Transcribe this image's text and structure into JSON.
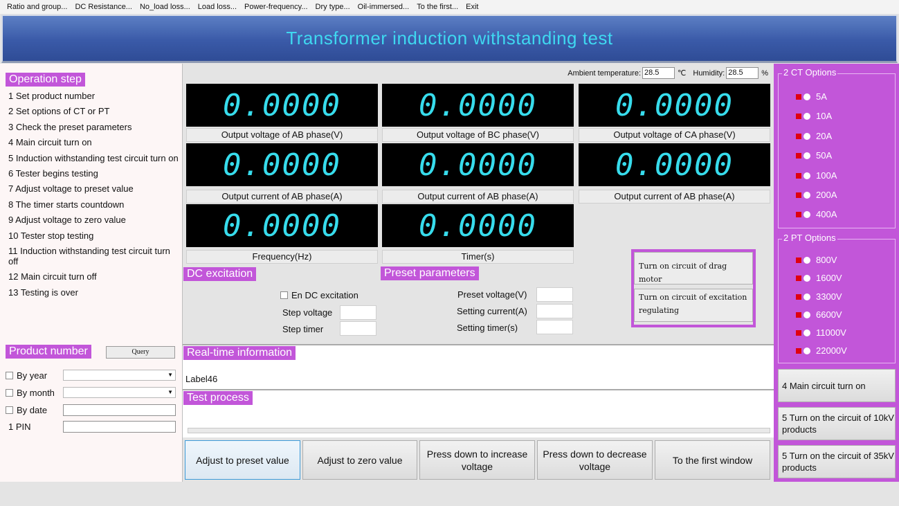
{
  "menu": [
    "Ratio and group...",
    "DC Resistance...",
    "No_load loss...",
    "Load loss...",
    "Power-frequency...",
    "Dry type...",
    "Oil-immersed...",
    "To the first...",
    "Exit"
  ],
  "header": {
    "title": "Transformer induction withstanding test"
  },
  "operation": {
    "title": "Operation step",
    "steps": [
      "1 Set product number",
      "2 Set options of CT or PT",
      "3 Check the preset parameters",
      "4 Main circuit turn on",
      "5 Induction withstanding test circuit turn on",
      "6 Tester begins testing",
      "7 Adjust voltage to preset value",
      "8 The timer starts countdown",
      "9 Adjust voltage to zero value",
      "10 Tester stop testing",
      "11 Induction withstanding test circuit turn off",
      "12 Main circuit turn off",
      "13 Testing is over"
    ]
  },
  "product": {
    "title": "Product number",
    "query": "Query",
    "by_year": "By year",
    "by_month": "By month",
    "by_date": "By date",
    "pin": "1 PIN"
  },
  "environment": {
    "temp_label": "Ambient temperature:",
    "temp_value": "28.5",
    "temp_unit": "℃",
    "humidity_label": "Humidity:",
    "humidity_value": "28.5",
    "humidity_unit": "%"
  },
  "meters": [
    {
      "value": "0.0000",
      "caption": "Output voltage of AB phase(V)"
    },
    {
      "value": "0.0000",
      "caption": "Output voltage of BC phase(V)"
    },
    {
      "value": "0.0000",
      "caption": "Output voltage of CA phase(V)"
    },
    {
      "value": "0.0000",
      "caption": "Output current of AB phase(A)"
    },
    {
      "value": "0.0000",
      "caption": "Output current of AB phase(A)"
    },
    {
      "value": "0.0000",
      "caption": "Output current of AB phase(A)"
    },
    {
      "value": "0.0000",
      "caption": "Frequency(Hz)"
    },
    {
      "value": "0.0000",
      "caption": "Timer(s)"
    }
  ],
  "dc": {
    "title": "DC excitation",
    "enable": "En DC excitation",
    "step_voltage": "Step voltage",
    "step_timer": "Step timer"
  },
  "preset": {
    "title": "Preset parameters",
    "voltage": "Preset voltage(V)",
    "current": "Setting current(A)",
    "timer": "Setting timer(s)"
  },
  "motor": {
    "drag": "Turn on circuit of drag motor",
    "excitation": "Turn on circuit of excitation regulating"
  },
  "realtime": {
    "title": "Real-time information",
    "label": "Label46"
  },
  "process": {
    "title": "Test process",
    "progress": 0
  },
  "actions": [
    "Adjust to preset value",
    "Adjust to zero value",
    "Press down to increase voltage",
    "Press down to decrease voltage",
    "To the first window"
  ],
  "ct": {
    "title": "2 CT Options",
    "options": [
      "5A",
      "10A",
      "20A",
      "50A",
      "100A",
      "200A",
      "400A"
    ]
  },
  "pt": {
    "title": "2 PT Options",
    "options": [
      "800V",
      "1600V",
      "3300V",
      "6600V",
      "11000V",
      "22000V"
    ]
  },
  "side_buttons": [
    "4 Main circuit turn on",
    "5 Turn on the circuit of 10kV products",
    "5 Turn on the circuit of 35kV products"
  ],
  "colors": {
    "accent": "#c256d9",
    "digit": "#37dcec",
    "banner_text": "#3fd8f0",
    "option_marker": "#e00010"
  }
}
